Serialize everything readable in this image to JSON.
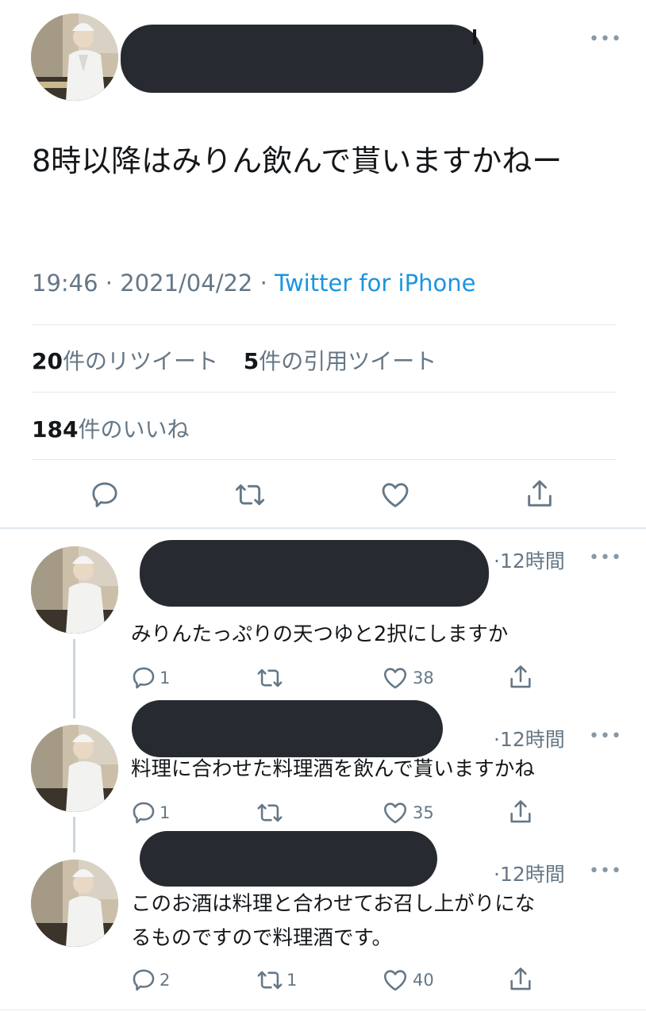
{
  "tweet": {
    "text": "8時以降はみりん飲んで貰いますかねー",
    "time": "19:46",
    "separator": "·",
    "date": "2021/04/22",
    "source": "Twitter for iPhone",
    "retweets_count": "20",
    "retweets_label": "件のリツイート",
    "quotes_count": "5",
    "quotes_label": "件の引用ツイート",
    "likes_count": "184",
    "likes_label": "件のいいね",
    "more": "•••"
  },
  "replies": [
    {
      "time": "·12時間",
      "text_lines": [
        "みりんたっぷりの天つゆと2択にしますか"
      ],
      "reply_count": "1",
      "retweet_count": "",
      "like_count": "38",
      "more": "•••"
    },
    {
      "time": "·12時間",
      "text_lines": [
        "料理に合わせた料理酒を飲んで貰いますかね"
      ],
      "reply_count": "1",
      "retweet_count": "",
      "like_count": "35",
      "more": "•••"
    },
    {
      "time": "·12時間",
      "text_lines": [
        "このお酒は料理と合わせてお召し上がりにな",
        "るものですので料理酒です。"
      ],
      "reply_count": "2",
      "retweet_count": "1",
      "like_count": "40",
      "more": "•••"
    }
  ],
  "colors": {
    "link": "#1b95e0",
    "muted": "#657786",
    "icon": "#657786",
    "redaction": "#272b31",
    "divider": "#e1e8ed"
  },
  "icons": [
    "more-icon",
    "reply-icon",
    "retweet-icon",
    "like-icon",
    "share-icon"
  ]
}
